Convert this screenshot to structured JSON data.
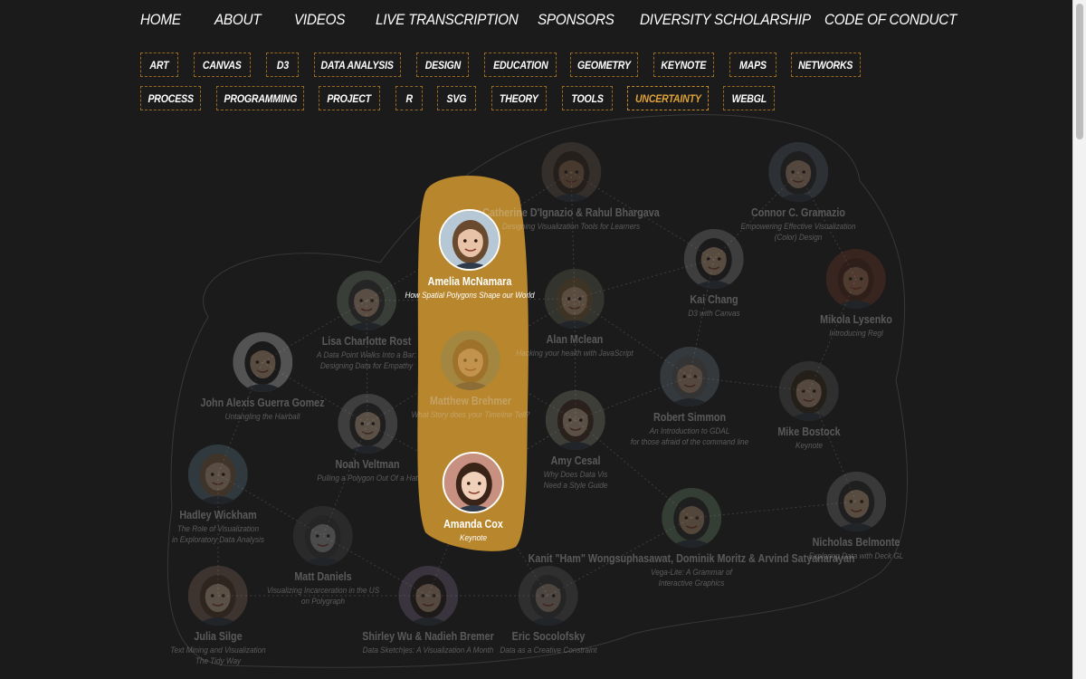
{
  "nav": [
    "HOME",
    "ABOUT",
    "VIDEOS",
    "LIVE TRANSCRIPTION",
    "SPONSORS",
    "DIVERSITY SCHOLARSHIP",
    "CODE OF CONDUCT"
  ],
  "tags_row1": [
    "ART",
    "CANVAS",
    "D3",
    "DATA ANALYSIS",
    "DESIGN",
    "EDUCATION",
    "GEOMETRY",
    "KEYNOTE",
    "MAPS",
    "NETWORKS"
  ],
  "tags_row2": [
    "PROCESS",
    "PROGRAMMING",
    "PROJECT",
    "R",
    "SVG",
    "THEORY",
    "TOOLS",
    "UNCERTAINTY",
    "WEBGL"
  ],
  "active_tag": "UNCERTAINTY",
  "colors": {
    "accent": "#e0a23a",
    "highlight_blob": "#b8862c",
    "background": "#1b1b1b"
  },
  "speakers": [
    {
      "name": "Catherine D'Ignazio & Rahul Bhargava",
      "talk": [
        "Designing Visualization Tools for Learners"
      ],
      "highlight": false,
      "skin": "#a87a5a",
      "hair": "#3a2a20",
      "bg": "#6b5a4a"
    },
    {
      "name": "Connor C. Gramazio",
      "talk": [
        "Empowering Effective Visualization",
        "(Color) Design"
      ],
      "highlight": false,
      "skin": "#c9a48a",
      "hair": "#2a2a2a",
      "bg": "#556070"
    },
    {
      "name": "Amelia McNamara",
      "talk": [
        "How Spatial Polygons Shape our World"
      ],
      "highlight": true,
      "skin": "#e8c3a7",
      "hair": "#6a4a2e",
      "bg": "#b6c7d6"
    },
    {
      "name": "Kai Chang",
      "talk": [
        "D3 with Canvas"
      ],
      "highlight": false,
      "skin": "#d8b090",
      "hair": "#1e1e1e",
      "bg": "#8a8a8a"
    },
    {
      "name": "Lisa Charlotte Rost",
      "talk": [
        "A Data Point Walks Into a Bar:",
        "Designing Data for Empathy"
      ],
      "highlight": false,
      "skin": "#e0b898",
      "hair": "#3a3a3a",
      "bg": "#7a8a7a"
    },
    {
      "name": "Alan Mclean",
      "talk": [
        "Hacking your health with JavaScript"
      ],
      "highlight": false,
      "skin": "#e0b890",
      "hair": "#8a6a3a",
      "bg": "#6a6a5a"
    },
    {
      "name": "Mikola Lysenko",
      "talk": [
        "Introducing Regl"
      ],
      "highlight": false,
      "skin": "#c08060",
      "hair": "#5a2a1a",
      "bg": "#7a3a2a"
    },
    {
      "name": "John Alexis Guerra Gomez",
      "talk": [
        "Untangling the Hairball"
      ],
      "highlight": false,
      "skin": "#d8b090",
      "hair": "#1a1a1a",
      "bg": "#c8c8c8"
    },
    {
      "name": "Matthew Brehmer",
      "talk": [
        "What Story does your Timeline Tell?"
      ],
      "highlight": false,
      "skin": "#d8b090",
      "hair": "#6a4a2a",
      "bg": "#7a8a6a"
    },
    {
      "name": "Robert Simmon",
      "talk": [
        "An Introduction to GDAL",
        "for those afraid of the command line"
      ],
      "highlight": false,
      "skin": "#d0a888",
      "hair": "#6a6a6a",
      "bg": "#6a7a8a"
    },
    {
      "name": "Mike Bostock",
      "talk": [
        "Keynote"
      ],
      "highlight": false,
      "skin": "#d0a888",
      "hair": "#3a2a1a",
      "bg": "#5a5a5a"
    },
    {
      "name": "Noah Veltman",
      "talk": [
        "Pulling a Polygon Out Of a Hat"
      ],
      "highlight": false,
      "skin": "#e0c0a0",
      "hair": "#2a2a2a",
      "bg": "#8a8a8a"
    },
    {
      "name": "Amy Cesal",
      "talk": [
        "Why Does Data Vis",
        "Need a Style Guide"
      ],
      "highlight": false,
      "skin": "#e0c0a0",
      "hair": "#4a3020",
      "bg": "#8a8a7a"
    },
    {
      "name": "Amanda Cox",
      "talk": [
        "Keynote"
      ],
      "highlight": true,
      "skin": "#f0d0b8",
      "hair": "#3a2418",
      "bg": "#c89080"
    },
    {
      "name": "Hadley Wickham",
      "talk": [
        "The Role of Visualization",
        "in Exploratory Data Analysis"
      ],
      "highlight": false,
      "skin": "#e0b898",
      "hair": "#8a6a4a",
      "bg": "#5a7a8a"
    },
    {
      "name": "Nicholas Belmonte",
      "talk": [
        "Exploring Data with Deck GL"
      ],
      "highlight": false,
      "skin": "#d8b090",
      "hair": "#2a2a2a",
      "bg": "#7a7a7a"
    },
    {
      "name": "Kanit \"Ham\" Wongsuphasawat, Dominik Moritz & Arvind Satyanarayan",
      "talk": [
        "Vega-Lite: A Grammar of",
        "Interactive Graphics"
      ],
      "highlight": false,
      "skin": "#c8a080",
      "hair": "#2a2a2a",
      "bg": "#6a8a6a"
    },
    {
      "name": "Matt Daniels",
      "talk": [
        "Visualizing Incarceration in the US",
        "on Polygraph"
      ],
      "highlight": false,
      "skin": "#b0b0b0",
      "hair": "#3a3a3a",
      "bg": "#4a4a4a"
    },
    {
      "name": "Julia Silge",
      "talk": [
        "Text Mining and Visualization",
        "The Tidy Way"
      ],
      "highlight": false,
      "skin": "#e0c0a0",
      "hair": "#5a3a2a",
      "bg": "#8a6a5a"
    },
    {
      "name": "Shirley Wu & Nadieh Bremer",
      "talk": [
        "Data Sketch|es: A Visualization A Month"
      ],
      "highlight": false,
      "skin": "#d0a888",
      "hair": "#2a1a1a",
      "bg": "#7a6a8a"
    },
    {
      "name": "Eric Socolofsky",
      "talk": [
        "Data as a Creative Constraint"
      ],
      "highlight": false,
      "skin": "#b8a090",
      "hair": "#3a3a3a",
      "bg": "#5a5a5a"
    }
  ]
}
